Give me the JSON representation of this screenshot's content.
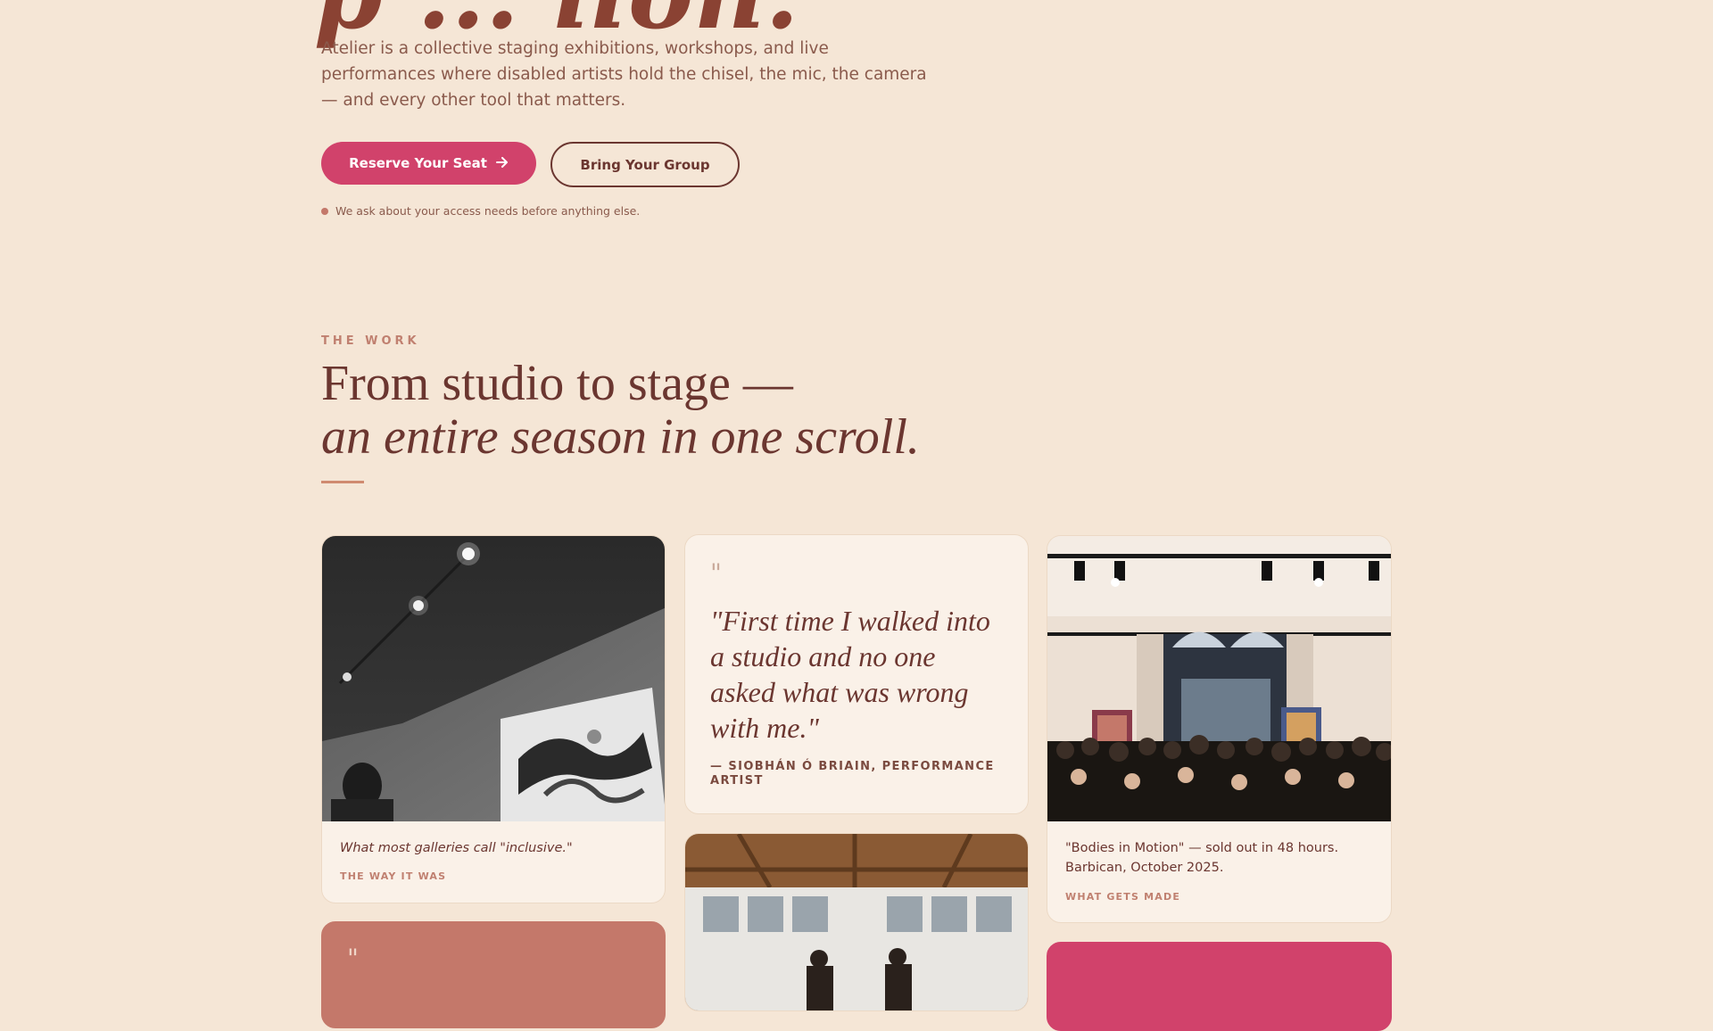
{
  "hero": {
    "title_fragment": "p  ...  lion.",
    "intro": "Atelier is a collective staging exhibitions, workshops, and live performances where disabled artists hold the chisel, the mic, the camera — and every other tool that matters.",
    "primary_cta": "Reserve Your Seat",
    "secondary_cta": "Bring Your Group",
    "access_note": "We ask about your access needs before anything else."
  },
  "work": {
    "eyebrow": "THE WORK",
    "title_line1": "From studio to stage —",
    "title_line2": "an entire season in one scroll."
  },
  "cards": {
    "gallery": {
      "caption": "What most galleries call \"inclusive.\"",
      "label": "THE WAY IT WAS"
    },
    "quote": {
      "mark": "\"",
      "text": "\"First time I walked into a studio and no one asked what was wrong with me.\"",
      "attribution": "— SIOBHÁN Ó BRIAIN, PERFORMANCE ARTIST"
    },
    "event": {
      "caption": "\"Bodies in Motion\" — sold out in 48 hours. Barbican, October 2025.",
      "label": "WHAT GETS MADE"
    },
    "partial_quote_mark": "\""
  },
  "colors": {
    "accent": "#d1426b",
    "terracotta": "#c4786a",
    "ink": "#6b3630",
    "background": "#f5e6d6"
  }
}
